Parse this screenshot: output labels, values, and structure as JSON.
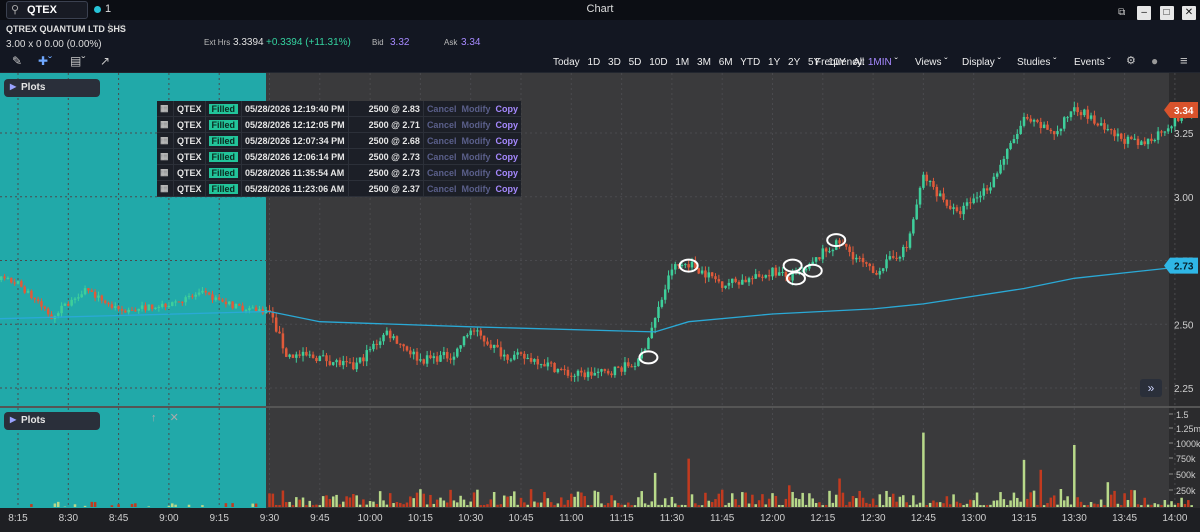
{
  "header": {
    "search_text": "QTEX",
    "link_group": "1",
    "window_title": "Chart",
    "window_buttons": [
      "⧉",
      "–",
      "□",
      "✕"
    ]
  },
  "quote": {
    "name": "QTREX QUANTUM LTD SHS",
    "price_line": "3.00 x 0  0.00 (0.00%)",
    "ext_label": "Ext Hrs",
    "ext_price": "3.3394",
    "ext_change": "+0.3394 (+11.31%)",
    "bid_label": "Bid",
    "bid": "3.32",
    "ask_label": "Ask",
    "ask": "3.34"
  },
  "toolbar": {
    "ranges": [
      "Today",
      "1D",
      "3D",
      "5D",
      "10D",
      "1M",
      "3M",
      "6M",
      "YTD",
      "1Y",
      "2Y",
      "5Y",
      "10Y",
      "All"
    ],
    "frequency_label": "Frequency:",
    "frequency_value": "1MIN",
    "views": "Views",
    "display": "Display",
    "studies": "Studies",
    "events": "Events"
  },
  "panels": {
    "price_title": "Plots",
    "volume_title": "Plots"
  },
  "orders": {
    "actions": [
      "Cancel",
      "Modify",
      "Copy"
    ],
    "rows": [
      {
        "symbol": "QTEX",
        "status": "Filled",
        "time": "05/28/2026 12:19:40 PM",
        "detail": "2500 @ 2.83"
      },
      {
        "symbol": "QTEX",
        "status": "Filled",
        "time": "05/28/2026 12:12:05 PM",
        "detail": "2500 @ 2.71"
      },
      {
        "symbol": "QTEX",
        "status": "Filled",
        "time": "05/28/2026 12:07:34 PM",
        "detail": "2500 @ 2.68"
      },
      {
        "symbol": "QTEX",
        "status": "Filled",
        "time": "05/28/2026 12:06:14 PM",
        "detail": "2500 @ 2.73"
      },
      {
        "symbol": "QTEX",
        "status": "Filled",
        "time": "05/28/2026 11:35:54 AM",
        "detail": "2500 @ 2.73"
      },
      {
        "symbol": "QTEX",
        "status": "Filled",
        "time": "05/28/2026 11:23:06 AM",
        "detail": "2500 @ 2.37"
      }
    ]
  },
  "colors": {
    "up": "#3ecf9b",
    "down": "#e05a3a",
    "vwap": "#2aa9d6",
    "premarket": "#21a9a9",
    "vol_up": "#b8d98a",
    "vol_down": "#c23a1f"
  },
  "chart_data": {
    "type": "candlestick",
    "x_ticks": [
      "8:15",
      "8:30",
      "8:45",
      "9:00",
      "9:15",
      "9:30",
      "9:45",
      "10:00",
      "10:15",
      "10:30",
      "10:45",
      "11:00",
      "11:15",
      "11:30",
      "11:45",
      "12:00",
      "12:15",
      "12:30",
      "12:45",
      "13:00",
      "13:15",
      "13:30",
      "13:45",
      "14:00"
    ],
    "price_ticks": [
      "3.25",
      "3.00",
      "2.75",
      "2.50",
      "2.25"
    ],
    "volume_ticks": [
      "1.5",
      "1.25m",
      "1000k",
      "750k",
      "500k",
      "250k"
    ],
    "ylim": [
      2.17,
      3.41
    ],
    "volume_max": 1500000,
    "last_price": "3.34",
    "vwap_last": "2.73",
    "premarket_end": "9:30",
    "price_path": [
      {
        "t": "8:05",
        "p": 2.7
      },
      {
        "t": "8:15",
        "p": 2.66
      },
      {
        "t": "8:25",
        "p": 2.53
      },
      {
        "t": "8:35",
        "p": 2.64
      },
      {
        "t": "8:45",
        "p": 2.55
      },
      {
        "t": "9:00",
        "p": 2.58
      },
      {
        "t": "9:10",
        "p": 2.62
      },
      {
        "t": "9:20",
        "p": 2.57
      },
      {
        "t": "9:30",
        "p": 2.55
      },
      {
        "t": "9:35",
        "p": 2.38
      },
      {
        "t": "9:45",
        "p": 2.37
      },
      {
        "t": "9:55",
        "p": 2.33
      },
      {
        "t": "10:05",
        "p": 2.47
      },
      {
        "t": "10:15",
        "p": 2.36
      },
      {
        "t": "10:25",
        "p": 2.38
      },
      {
        "t": "10:30",
        "p": 2.48
      },
      {
        "t": "10:40",
        "p": 2.38
      },
      {
        "t": "10:50",
        "p": 2.36
      },
      {
        "t": "11:00",
        "p": 2.3
      },
      {
        "t": "11:10",
        "p": 2.31
      },
      {
        "t": "11:20",
        "p": 2.35
      },
      {
        "t": "11:25",
        "p": 2.52
      },
      {
        "t": "11:30",
        "p": 2.72
      },
      {
        "t": "11:35",
        "p": 2.74
      },
      {
        "t": "11:45",
        "p": 2.66
      },
      {
        "t": "11:55",
        "p": 2.68
      },
      {
        "t": "12:00",
        "p": 2.71
      },
      {
        "t": "12:05",
        "p": 2.68
      },
      {
        "t": "12:10",
        "p": 2.71
      },
      {
        "t": "12:15",
        "p": 2.78
      },
      {
        "t": "12:20",
        "p": 2.82
      },
      {
        "t": "12:30",
        "p": 2.7
      },
      {
        "t": "12:40",
        "p": 2.8
      },
      {
        "t": "12:45",
        "p": 3.08
      },
      {
        "t": "12:55",
        "p": 2.93
      },
      {
        "t": "13:05",
        "p": 3.05
      },
      {
        "t": "13:15",
        "p": 3.3
      },
      {
        "t": "13:25",
        "p": 3.25
      },
      {
        "t": "13:30",
        "p": 3.36
      },
      {
        "t": "13:40",
        "p": 3.25
      },
      {
        "t": "13:50",
        "p": 3.2
      },
      {
        "t": "14:00",
        "p": 3.3
      },
      {
        "t": "14:05",
        "p": 3.34
      }
    ],
    "vwap_path": [
      {
        "t": "8:05",
        "p": 2.52
      },
      {
        "t": "9:30",
        "p": 2.55
      },
      {
        "t": "9:45",
        "p": 2.51
      },
      {
        "t": "10:30",
        "p": 2.49
      },
      {
        "t": "11:25",
        "p": 2.47
      },
      {
        "t": "11:35",
        "p": 2.51
      },
      {
        "t": "12:00",
        "p": 2.54
      },
      {
        "t": "12:30",
        "p": 2.56
      },
      {
        "t": "12:45",
        "p": 2.58
      },
      {
        "t": "13:15",
        "p": 2.64
      },
      {
        "t": "13:30",
        "p": 2.68
      },
      {
        "t": "14:05",
        "p": 2.73
      }
    ],
    "marked_fills": [
      {
        "t": "11:23",
        "p": 2.37
      },
      {
        "t": "11:35",
        "p": 2.73
      },
      {
        "t": "12:06",
        "p": 2.73
      },
      {
        "t": "12:07",
        "p": 2.68
      },
      {
        "t": "12:12",
        "p": 2.71
      },
      {
        "t": "12:19",
        "p": 2.83
      }
    ],
    "volume_spikes": [
      {
        "t": "11:25",
        "v": 550000
      },
      {
        "t": "11:35",
        "v": 780000
      },
      {
        "t": "12:05",
        "v": 350000
      },
      {
        "t": "12:20",
        "v": 460000
      },
      {
        "t": "12:45",
        "v": 1200000
      },
      {
        "t": "13:15",
        "v": 760000
      },
      {
        "t": "13:20",
        "v": 600000
      },
      {
        "t": "13:30",
        "v": 1000000
      },
      {
        "t": "13:40",
        "v": 400000
      }
    ]
  }
}
